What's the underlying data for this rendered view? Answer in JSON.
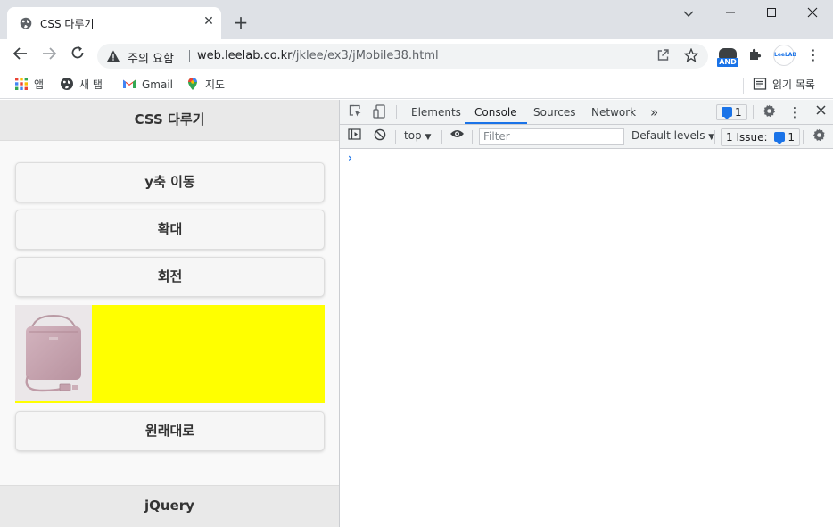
{
  "browser": {
    "tab": {
      "title": "CSS 다루기",
      "close": "✕"
    },
    "new_tab": "+",
    "window_controls": {
      "minimize": "—",
      "maximize": "☐",
      "close": "✕",
      "tabsearch": "⌄"
    },
    "nav": {
      "back": "←",
      "forward": "→",
      "reload": "↻"
    },
    "address": {
      "security_label": "주의 요함",
      "url_host": "web.leelab.co.kr",
      "url_path": "/jklee/ex3/jMobile38.html"
    },
    "extensions": {
      "and_badge": "AND",
      "leelab_badge": "LeeLAB",
      "menu": "⋮"
    },
    "bookmarks": {
      "apps": "앱",
      "new_tab": "새 탭",
      "gmail": "Gmail",
      "maps": "지도",
      "reading_list": "읽기 목록"
    }
  },
  "page": {
    "header": "CSS 다루기",
    "buttons": [
      "y축 이동",
      "확대",
      "회전",
      "원래대로"
    ],
    "footer": "jQuery"
  },
  "devtools": {
    "tabs": [
      "Elements",
      "Console",
      "Sources",
      "Network"
    ],
    "active_tab": "Console",
    "more_tabs": "»",
    "issue_count": "1",
    "context": "top",
    "filter_placeholder": "Filter",
    "levels": "Default levels",
    "issues_label": "1 Issue:",
    "issues_count": "1",
    "prompt": "›"
  },
  "colors": {
    "accent": "#1a73e8",
    "yellow_box": "#ffff00",
    "titlebar": "#dee1e6"
  }
}
